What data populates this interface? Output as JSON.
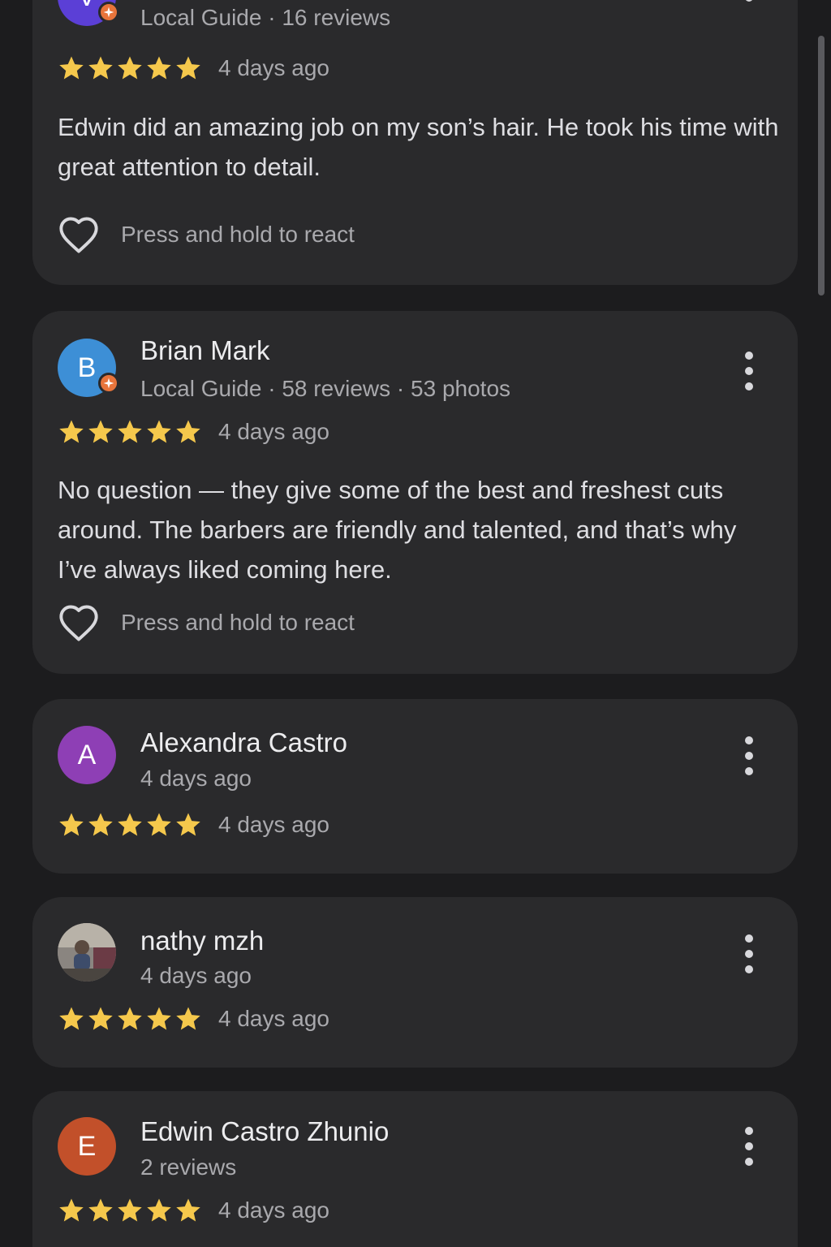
{
  "colors": {
    "background": "#1c1c1e",
    "card": "#2a2a2c",
    "star": "#f5c84c",
    "local_guide_badge": "#e8743b"
  },
  "reviews": [
    {
      "author": "",
      "avatar_letter": "V",
      "avatar_color": "#5b3fd6",
      "local_guide": true,
      "meta": "Local Guide · 16 reviews",
      "rating": 5,
      "time": "4 days ago",
      "text": "Edwin did an amazing job on my son’s hair. He took his time with great attention to detail.",
      "react_label": "Press and hold to react"
    },
    {
      "author": "Brian Mark",
      "avatar_letter": "B",
      "avatar_color": "#3d8fd6",
      "local_guide": true,
      "meta": "Local Guide · 58 reviews · 53 photos",
      "rating": 5,
      "time": "4 days ago",
      "text": "No question — they give some of the best and freshest cuts around. The barbers are friendly and talented, and that’s why I’ve always liked coming here.",
      "react_label": "Press and hold to react"
    },
    {
      "author": "Alexandra Castro",
      "avatar_letter": "A",
      "avatar_color": "#8e3fb5",
      "local_guide": false,
      "meta": "4 days ago",
      "rating": 5,
      "time": "4 days ago"
    },
    {
      "author": "nathy mzh",
      "avatar_letter": "",
      "avatar_color": "#6a6560",
      "local_guide": false,
      "meta": "4 days ago",
      "rating": 5,
      "time": "4 days ago"
    },
    {
      "author": "Edwin Castro Zhunio",
      "avatar_letter": "E",
      "avatar_color": "#c2502a",
      "local_guide": false,
      "meta": "2 reviews",
      "rating": 5,
      "time": "4 days ago"
    }
  ]
}
